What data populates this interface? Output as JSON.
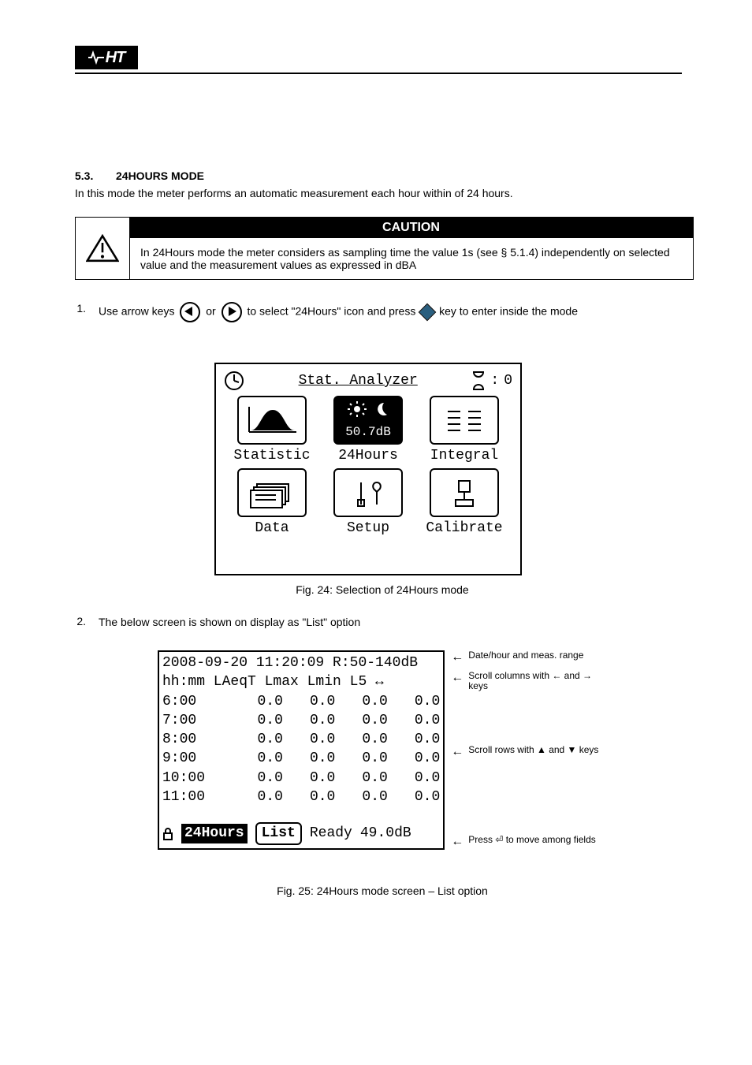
{
  "header": {
    "logo_text": "HT"
  },
  "section": {
    "number": "5.3.",
    "title": "24HOURS MODE",
    "body": "In this mode the meter performs an automatic measurement each hour within of 24 hours."
  },
  "caution": {
    "title": "CAUTION",
    "left_icon": "warning-triangle-icon",
    "body": "In 24Hours mode the meter considers as sampling time the value 1s (see § 5.1.4) independently on selected value and the measurement values as expressed in dBA"
  },
  "step1": {
    "bullet": "1.",
    "prefix": "Use arrow keys ",
    "icon1": "left-arrow-icon",
    "sep": " or ",
    "icon2": "right-arrow-icon",
    "mid": " to select \"24Hours\" icon and press ",
    "enterIcon": "enter-diamond-icon",
    "tail": " key to enter inside the mode"
  },
  "fig24": {
    "top": {
      "clock": "clock-icon",
      "title": "Stat. Analyzer",
      "hourglass": "hourglass-icon",
      "count": "0"
    },
    "modes_row1": {
      "left": {
        "icon": "statistic-curve-icon",
        "label": "Statistic"
      },
      "center": {
        "sun": "sun-icon",
        "moon": "moon-icon",
        "value": "50.7dB",
        "label": "24Hours",
        "selected": true
      },
      "right": {
        "icon": "integral-list-icon",
        "label": "Integral"
      }
    },
    "modes_row2": {
      "left": {
        "icon": "data-folder-icon",
        "label": "Data"
      },
      "center": {
        "icon": "setup-tools-icon",
        "label": "Setup"
      },
      "right": {
        "icon": "calibrate-icon",
        "label": "Calibrate"
      }
    },
    "caption": "Fig. 24: Selection of 24Hours mode"
  },
  "step2": {
    "bullet": "2.",
    "body": "The below screen is shown on display as \"List\" option"
  },
  "fig25": {
    "header_line": "2008-09-20 11:20:09 R:50-140dB",
    "columns_line": "hh:mm LAeqT  Lmax  Lmin  L5 ↔",
    "rows": [
      {
        "t": "6:00",
        "a": "0.0",
        "b": "0.0",
        "c": "0.0",
        "d": "0.0"
      },
      {
        "t": "7:00",
        "a": "0.0",
        "b": "0.0",
        "c": "0.0",
        "d": "0.0"
      },
      {
        "t": "8:00",
        "a": "0.0",
        "b": "0.0",
        "c": "0.0",
        "d": "0.0"
      },
      {
        "t": "9:00",
        "a": "0.0",
        "b": "0.0",
        "c": "0.0",
        "d": "0.0"
      },
      {
        "t": "10:00",
        "a": "0.0",
        "b": "0.0",
        "c": "0.0",
        "d": "0.0"
      },
      {
        "t": "11:00",
        "a": "0.0",
        "b": "0.0",
        "c": "0.0",
        "d": "0.0"
      }
    ],
    "footer": {
      "lock": "lock-icon",
      "mode": "24Hours",
      "btn": "List",
      "status": "Ready",
      "value": "49.0dB"
    },
    "note_top": "Date/hour and meas. range",
    "note_cols": "Scroll columns with ← and → keys",
    "note_rows": "Scroll rows with ▲ and ▼ keys",
    "note_footer": "Press ⏎ to move among fields",
    "caption": "Fig. 25: 24Hours mode screen – List option"
  }
}
